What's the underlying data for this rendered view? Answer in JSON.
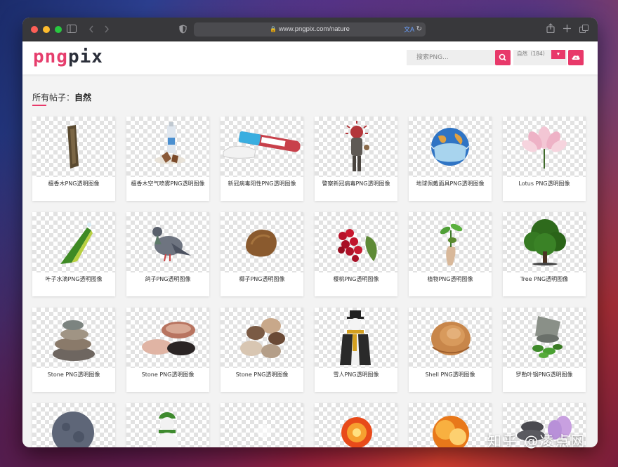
{
  "browser": {
    "url": "www.pngpix.com/nature",
    "tab_sidebar_icon": "sidebar-icon",
    "back_icon": "chevron-left-icon",
    "forward_icon": "chevron-right-icon",
    "shield_icon": "shield-icon",
    "share_icon": "share-icon",
    "new_tab_icon": "plus-icon",
    "tabs_icon": "tabs-overview-icon"
  },
  "site": {
    "logo_part1": "png",
    "logo_part2": "pix",
    "search_placeholder": "搜索PNG...",
    "category_select": "自然（184）",
    "accent_color": "#e8396a"
  },
  "page": {
    "title_prefix": "所有帖子：",
    "title_category": "自然"
  },
  "items": [
    {
      "caption": "檀香木PNG透明图像",
      "icon": "sandalwood-log"
    },
    {
      "caption": "檀香木空气喷雾PNG透明图像",
      "icon": "air-spray"
    },
    {
      "caption": "新冠病毒阳性PNG透明图像",
      "icon": "test-tube"
    },
    {
      "caption": "警察新冠病毒PNG透明图像",
      "icon": "virus-figure"
    },
    {
      "caption": "地球佩戴面具PNG透明图像",
      "icon": "masked-globe"
    },
    {
      "caption": "Lotus PNG透明图像",
      "icon": "lotus"
    },
    {
      "caption": "叶子水滴PNG透明图像",
      "icon": "leaf-drop"
    },
    {
      "caption": "鸽子PNG透明图像",
      "icon": "pigeon"
    },
    {
      "caption": "椰子PNG透明图像",
      "icon": "coconut"
    },
    {
      "caption": "樱桃PNG透明图像",
      "icon": "cherries"
    },
    {
      "caption": "植物PNG透明图像",
      "icon": "plant-hand"
    },
    {
      "caption": "Tree PNG透明图像",
      "icon": "tree"
    },
    {
      "caption": "Stone PNG透明图像",
      "icon": "stone-stack"
    },
    {
      "caption": "Stone PNG透明图像",
      "icon": "stones-mixed"
    },
    {
      "caption": "Stone PNG透明图像",
      "icon": "pebbles"
    },
    {
      "caption": "雪人PNG透明图像",
      "icon": "snowman"
    },
    {
      "caption": "Shell PNG透明图像",
      "icon": "shell"
    },
    {
      "caption": "罗勒叶锅PNG透明图像",
      "icon": "basil-pot"
    },
    {
      "caption": "",
      "icon": "moon"
    },
    {
      "caption": "",
      "icon": "snowman-green"
    },
    {
      "caption": "",
      "icon": "blank"
    },
    {
      "caption": "",
      "icon": "fireball"
    },
    {
      "caption": "",
      "icon": "explosion"
    },
    {
      "caption": "",
      "icon": "stones-flower"
    }
  ],
  "watermark": "知乎 @凌点网"
}
